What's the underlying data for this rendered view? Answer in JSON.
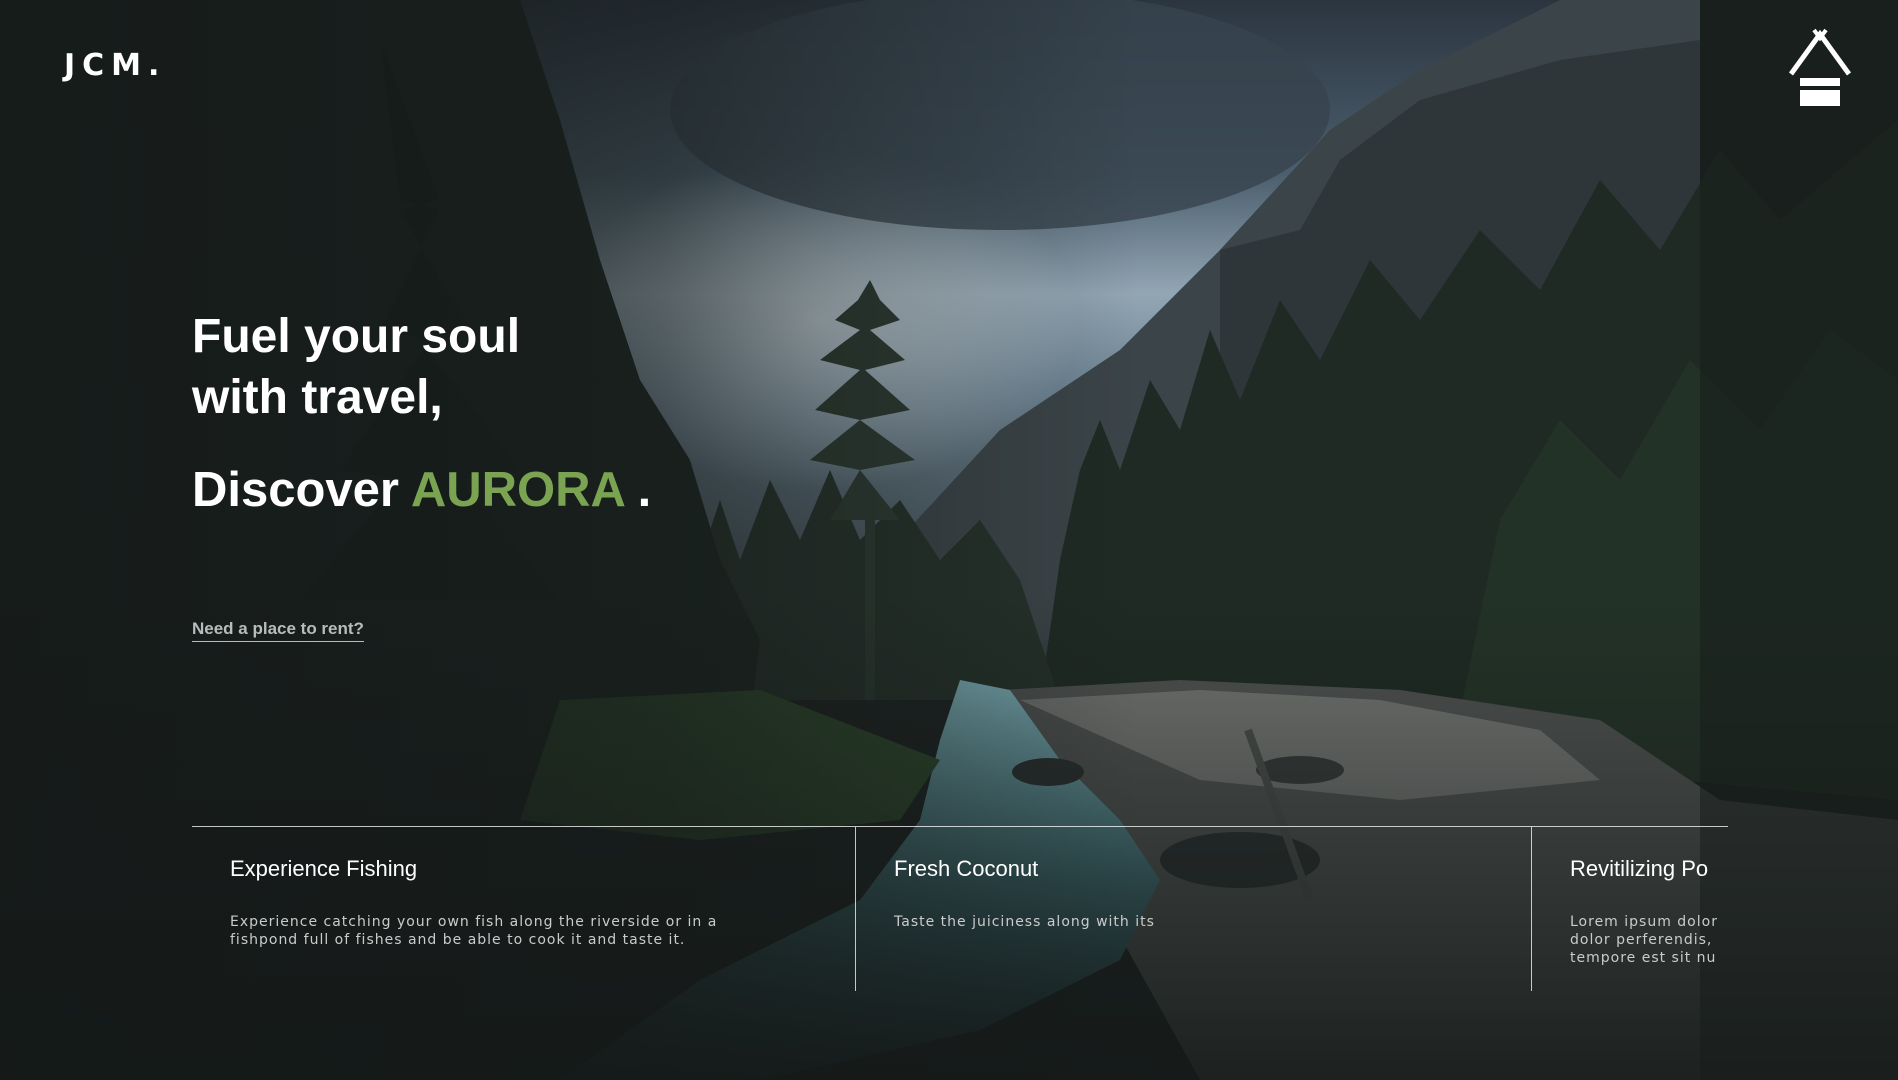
{
  "brand": {
    "logo_text": "JCM.",
    "icon": "cabin-icon"
  },
  "hero": {
    "line1": "Fuel your soul",
    "line2": "with travel,",
    "discover_prefix": "Discover ",
    "discover_highlight": "AURORA",
    "discover_suffix": " ."
  },
  "cta": {
    "rent_link": "Need a place to rent?"
  },
  "features": [
    {
      "title": "Experience Fishing",
      "description": "Experience catching your own fish along the riverside or in a fishpond full of fishes and be able to cook it and taste it."
    },
    {
      "title": "Fresh Coconut",
      "description": "Taste the juiciness along with its"
    },
    {
      "title": "Revitilizing Po",
      "description": "Lorem ipsum dolor dolor perferendis, tempore est sit nu"
    }
  ],
  "colors": {
    "accent": "#7aa452",
    "text": "#ffffff",
    "muted": "#b9bcbc"
  }
}
